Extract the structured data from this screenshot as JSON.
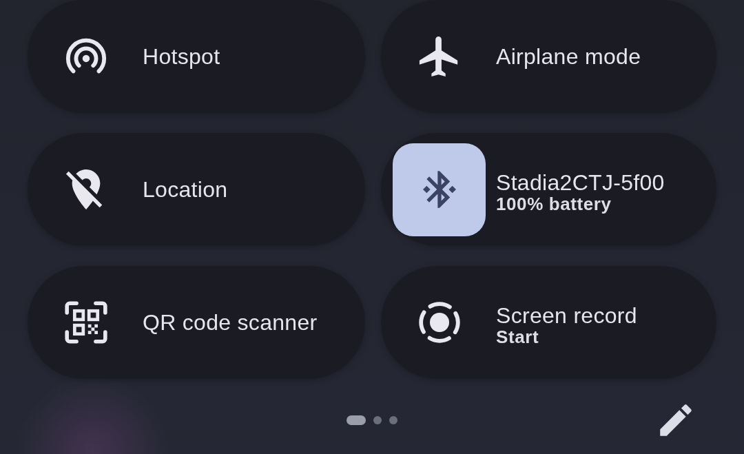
{
  "tiles": [
    {
      "label": "Hotspot",
      "active": false
    },
    {
      "label": "Airplane mode",
      "active": false
    },
    {
      "label": "Location",
      "active": false
    },
    {
      "label": "Stadia2CTJ-5f00",
      "secondary_label": "100% battery",
      "active": true
    },
    {
      "label": "QR code scanner",
      "active": false
    },
    {
      "label": "Screen record",
      "secondary_label": "Start",
      "active": false
    }
  ],
  "pager": [
    {
      "selected": true
    },
    {
      "selected": false
    },
    {
      "selected": false
    }
  ]
}
